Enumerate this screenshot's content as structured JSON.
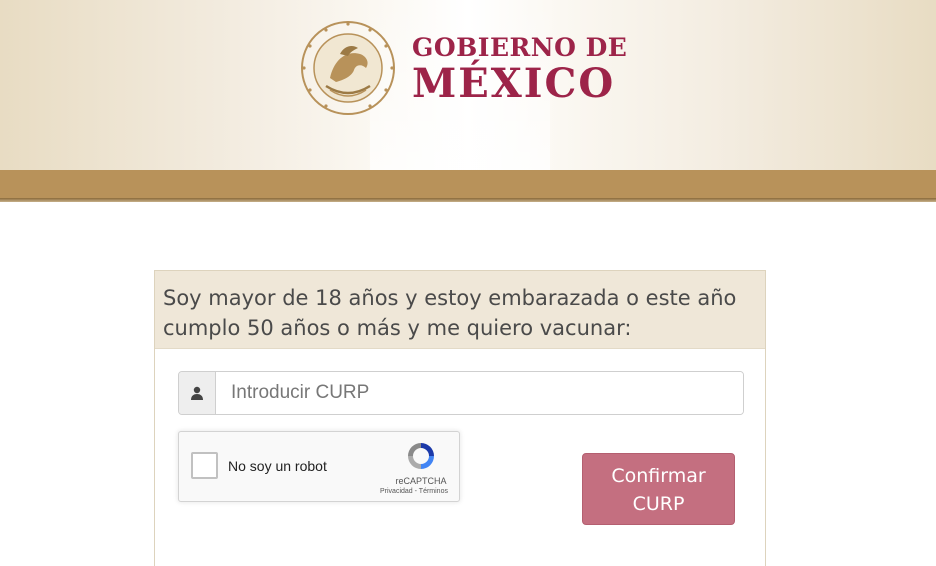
{
  "header": {
    "logo_line1": "GOBIERNO DE",
    "logo_line2": "MÉXICO",
    "brand_color": "#9d2449",
    "band_color": "#b8925a",
    "seal_icon": "eagle-seal-icon"
  },
  "form": {
    "heading": "Soy mayor de 18 años y estoy embarazada o este año cumplo 50 años o más y me quiero vacunar:",
    "curp_placeholder": "Introducir CURP",
    "curp_value": "",
    "user_icon": "user-icon",
    "recaptcha": {
      "label": "No soy un robot",
      "brand": "reCAPTCHA",
      "privacy": "Privacidad",
      "separator": " - ",
      "terms": "Términos",
      "checked": false
    },
    "confirm_button": "Confirmar CURP",
    "button_color": "#c46f80"
  }
}
